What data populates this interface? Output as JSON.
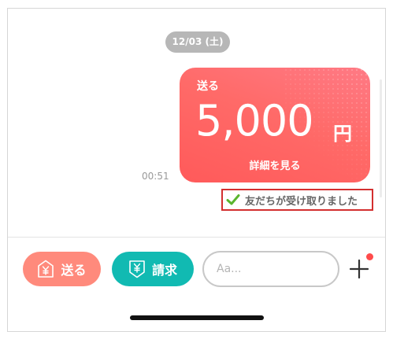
{
  "chat": {
    "date_label": "12/03 (土)",
    "message": {
      "type_label": "送る",
      "amount": "5,000",
      "currency": "円",
      "details_link": "詳細を見る",
      "time": "00:51",
      "status": "友だちが受け取りました"
    }
  },
  "bottom_bar": {
    "send_label": "送る",
    "request_label": "請求",
    "input_placeholder": "Aa..."
  },
  "colors": {
    "card_gradient_start": "#ff7a85",
    "card_gradient_end": "#ff5a5a",
    "send_button": "#ff8a7c",
    "request_button": "#11bab2",
    "highlight_border": "#d32f2f",
    "check_green": "#5ab52e",
    "notification_dot": "#ff4b4b"
  },
  "icons": {
    "check": "check-icon",
    "send": "yen-send-icon",
    "request": "yen-request-icon",
    "plus": "plus-icon"
  }
}
